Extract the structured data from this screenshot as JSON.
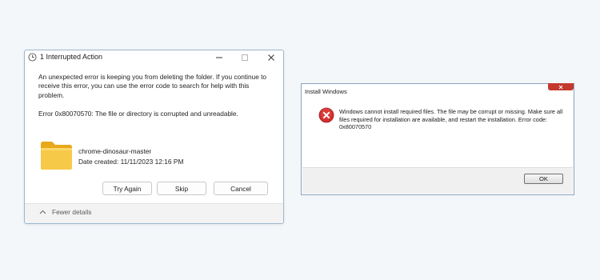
{
  "interrupted_dialog": {
    "title": "1 Interrupted Action",
    "message": "An unexpected error is keeping you from deleting the folder. If you continue to receive this error, you can use the error code to search for help with this problem.",
    "error_text": "Error 0x80070570: The file or directory is corrupted and unreadable.",
    "item": {
      "name": "chrome-dinosaur-master",
      "date_created": "Date created: 11/11/2023 12:16 PM",
      "icon": "folder-icon"
    },
    "buttons": {
      "try_again": "Try Again",
      "skip": "Skip",
      "cancel": "Cancel"
    },
    "footer": {
      "toggle_label": "Fewer details",
      "icon": "chevron-up-icon"
    },
    "title_icon": "clock-icon",
    "window_controls": [
      "minimize-icon",
      "maximize-icon",
      "close-icon"
    ],
    "colors": {
      "folder": "#f7c948",
      "border": "#9db7cf",
      "footer": "#f3f3f3"
    }
  },
  "install_dialog": {
    "title": "Install Windows",
    "message": "Windows cannot install required files. The file may be corrupt or missing. Make sure all files required for installation are available, and restart the installation. Error code: 0x80070570",
    "ok_label": "OK",
    "icon": "error-icon",
    "colors": {
      "error": "#d32f2f",
      "close_button": "#c4392e"
    }
  }
}
